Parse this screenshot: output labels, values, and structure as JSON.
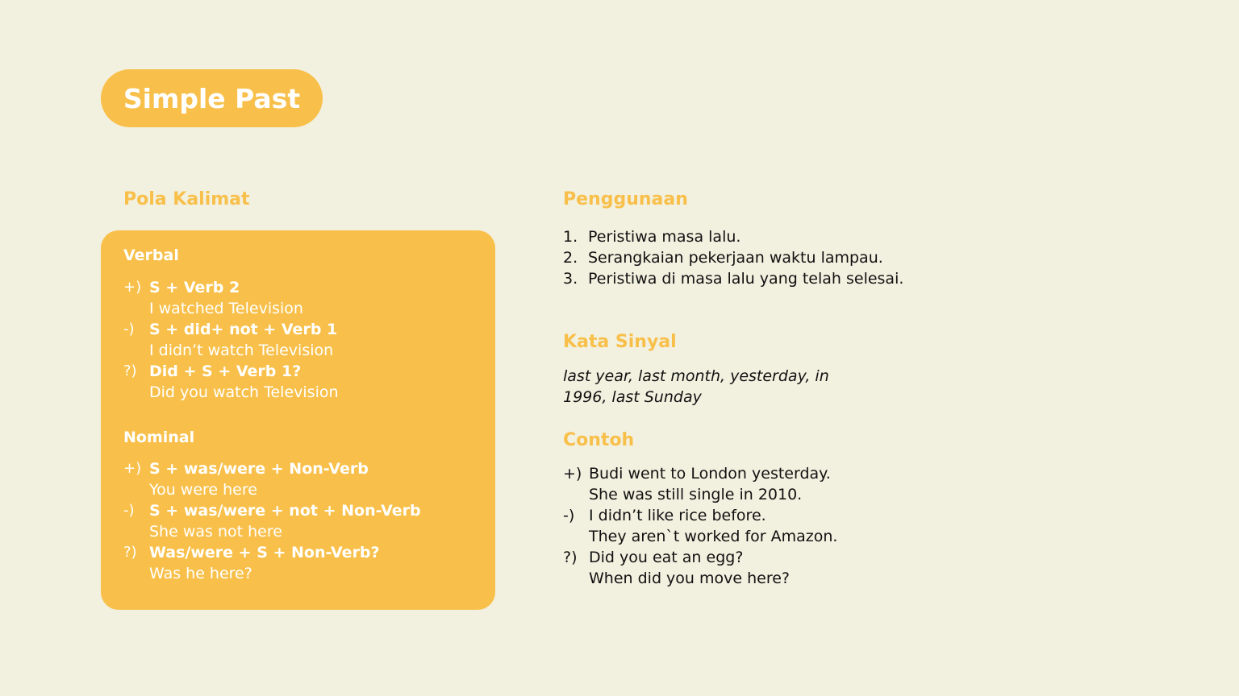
{
  "title": "Simple Past",
  "pola_kalimat": {
    "heading": "Pola Kalimat",
    "verbal": {
      "heading": "Verbal",
      "items": [
        {
          "marker": "+)",
          "formula": "S + Verb 2",
          "example": "I watched Television"
        },
        {
          "marker": "-)",
          "formula": "S + did+ not + Verb 1",
          "example": "I didn’t watch Television"
        },
        {
          "marker": "?)",
          "formula": "Did + S + Verb 1?",
          "example": "Did you watch Television"
        }
      ]
    },
    "nominal": {
      "heading": "Nominal",
      "items": [
        {
          "marker": "+)",
          "formula": "S + was/were + Non-Verb",
          "example": "You were here"
        },
        {
          "marker": "-)",
          "formula": "S + was/were + not + Non-Verb",
          "example": "She was not here"
        },
        {
          "marker": "?)",
          "formula": "Was/were + S + Non-Verb?",
          "example": "Was he here?"
        }
      ]
    }
  },
  "penggunaan": {
    "heading": "Penggunaan",
    "items": [
      {
        "number": "1.",
        "text": "Peristiwa masa lalu."
      },
      {
        "number": "2.",
        "text": "Serangkaian pekerjaan waktu lampau."
      },
      {
        "number": "3.",
        "text": "Peristiwa di masa lalu yang telah selesai."
      }
    ]
  },
  "kata_sinyal": {
    "heading": "Kata Sinyal",
    "text": "last year, last month, yesterday, in 1996, last Sunday"
  },
  "contoh": {
    "heading": "Contoh",
    "items": [
      {
        "marker": "+)",
        "lines": [
          "Budi went to London yesterday.",
          "She was still single in 2010."
        ]
      },
      {
        "marker": "-)",
        "lines": [
          "I didn’t like rice before.",
          "They aren`t worked for Amazon."
        ]
      },
      {
        "marker": "?)",
        "lines": [
          "Did you eat an egg?",
          "When did you move here?"
        ]
      }
    ]
  },
  "colors": {
    "background": "#f2f0df",
    "accent": "#f8c04a",
    "body_text": "#111111",
    "on_accent_text": "#ffffff"
  }
}
